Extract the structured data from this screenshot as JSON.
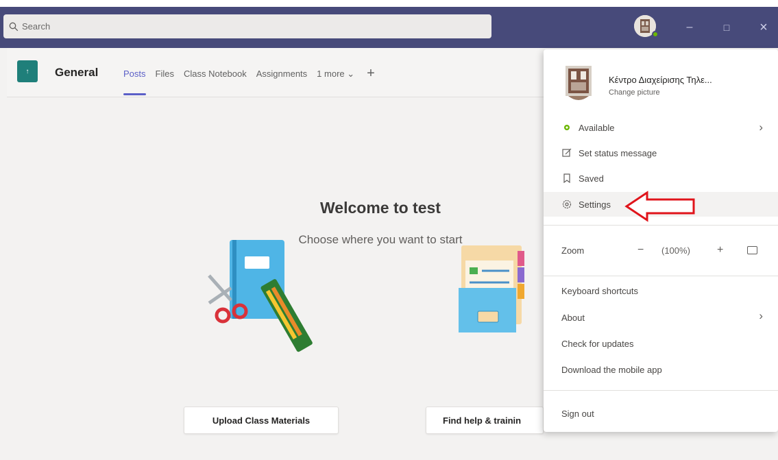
{
  "search": {
    "placeholder": "Search"
  },
  "window_controls": {
    "minimize": "–",
    "maximize": "□",
    "close": "×"
  },
  "channel": {
    "tile_glyph": "↑",
    "title": "General",
    "tabs": [
      {
        "label": "Posts",
        "active": true
      },
      {
        "label": "Files"
      },
      {
        "label": "Class Notebook"
      },
      {
        "label": "Assignments"
      },
      {
        "label": "1 more ⌄"
      }
    ],
    "add_tab": "+"
  },
  "welcome": {
    "title": "Welcome to test",
    "subtitle": "Choose where you want to start",
    "upload_button": "Upload Class Materials",
    "help_button": "Find help & trainin"
  },
  "profile_menu": {
    "name": "Κέντρο Διαχείρισης Τηλε...",
    "change_picture": "Change picture",
    "status": "Available",
    "set_status_message": "Set status message",
    "saved": "Saved",
    "settings": "Settings",
    "zoom": {
      "label": "Zoom",
      "minus": "−",
      "value": "(100%)",
      "plus": "+"
    },
    "keyboard_shortcuts": "Keyboard shortcuts",
    "about": "About",
    "check_updates": "Check for updates",
    "download_mobile": "Download the mobile app",
    "sign_out": "Sign out",
    "chevron": "›"
  },
  "colors": {
    "title_bar": "#474a7a",
    "accent": "#5b5fc7",
    "presence_available": "#6bb700",
    "annotation_arrow": "#e0141b",
    "team_tile": "#1f7f7a"
  }
}
